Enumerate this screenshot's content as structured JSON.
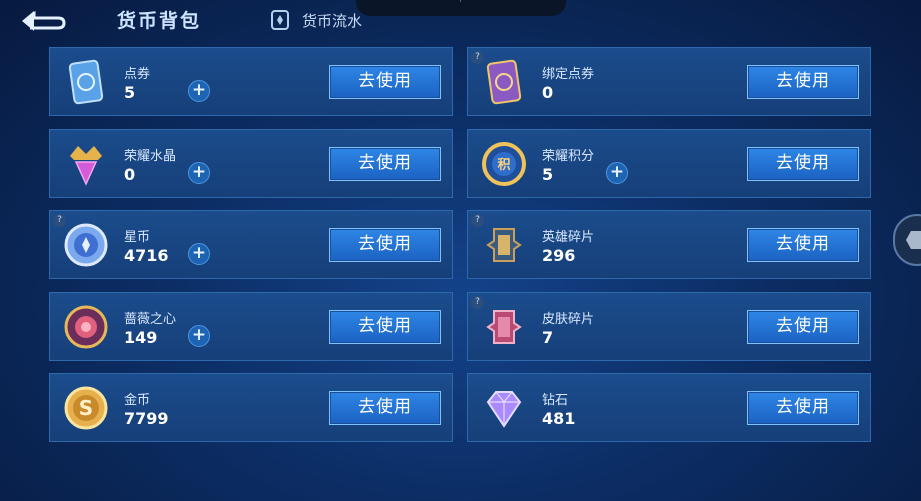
{
  "header": {
    "title": "货币背包",
    "flow_link": "货币流水"
  },
  "cards": [
    {
      "name": "点券",
      "amount": "5",
      "use_label": "去使用",
      "has_plus": true
    },
    {
      "name": "绑定点券",
      "amount": "0",
      "use_label": "去使用",
      "has_plus": false
    },
    {
      "name": "荣耀水晶",
      "amount": "0",
      "use_label": "去使用",
      "has_plus": true
    },
    {
      "name": "荣耀积分",
      "amount": "5",
      "use_label": "去使用",
      "has_plus": true
    },
    {
      "name": "星币",
      "amount": "4716",
      "use_label": "去使用",
      "has_plus": true
    },
    {
      "name": "英雄碎片",
      "amount": "296",
      "use_label": "去使用",
      "has_plus": false
    },
    {
      "name": "蔷薇之心",
      "amount": "149",
      "use_label": "去使用",
      "has_plus": true
    },
    {
      "name": "皮肤碎片",
      "amount": "7",
      "use_label": "去使用",
      "has_plus": false
    },
    {
      "name": "金币",
      "amount": "7799",
      "use_label": "去使用",
      "has_plus": false
    },
    {
      "name": "钻石",
      "amount": "481",
      "use_label": "去使用",
      "has_plus": false
    }
  ],
  "colors": {
    "card_bg": "#1b4c8c",
    "button": "#2e86e6",
    "page_bg": "#0c2e66"
  }
}
